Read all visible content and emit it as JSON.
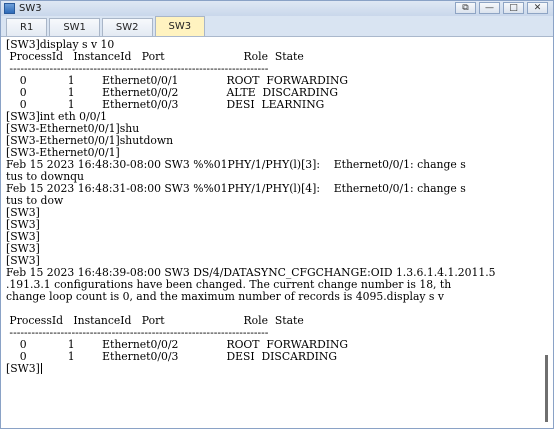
{
  "window": {
    "title": "SW3",
    "controls": {
      "restore": "⧉",
      "minimize": "—",
      "maximize": "□",
      "close": "✕"
    }
  },
  "tabs": [
    {
      "label": "R1",
      "active": false
    },
    {
      "label": "SW1",
      "active": false
    },
    {
      "label": "SW2",
      "active": false
    },
    {
      "label": "SW3",
      "active": true
    }
  ],
  "terminal": {
    "lines": [
      "[SW3]display s v 10",
      " ProcessId   InstanceId   Port                       Role  State",
      " -----------------------------------------------------------------------",
      "    0            1        Ethernet0/0/1              ROOT  FORWARDING",
      "    0            1        Ethernet0/0/2              ALTE  DISCARDING",
      "    0            1        Ethernet0/0/3              DESI  LEARNING",
      "[SW3]int eth 0/0/1",
      "[SW3-Ethernet0/0/1]shu",
      "[SW3-Ethernet0/0/1]shutdown",
      "[SW3-Ethernet0/0/1]",
      "Feb 15 2023 16:48:30-08:00 SW3 %%01PHY/1/PHY(l)[3]:    Ethernet0/0/1: change s",
      "tus to downqu",
      "Feb 15 2023 16:48:31-08:00 SW3 %%01PHY/1/PHY(l)[4]:    Ethernet0/0/1: change s",
      "tus to dow",
      "[SW3]",
      "[SW3]",
      "[SW3]",
      "[SW3]",
      "[SW3]",
      "Feb 15 2023 16:48:39-08:00 SW3 DS/4/DATASYNC_CFGCHANGE:OID 1.3.6.1.4.1.2011.5",
      ".191.3.1 configurations have been changed. The current change number is 18, th",
      "change loop count is 0, and the maximum number of records is 4095.display s v",
      "",
      " ProcessId   InstanceId   Port                       Role  State",
      " -----------------------------------------------------------------------",
      "    0            1        Ethernet0/0/2              ROOT  FORWARDING",
      "    0            1        Ethernet0/0/3              DESI  DISCARDING",
      "[SW3]"
    ]
  }
}
